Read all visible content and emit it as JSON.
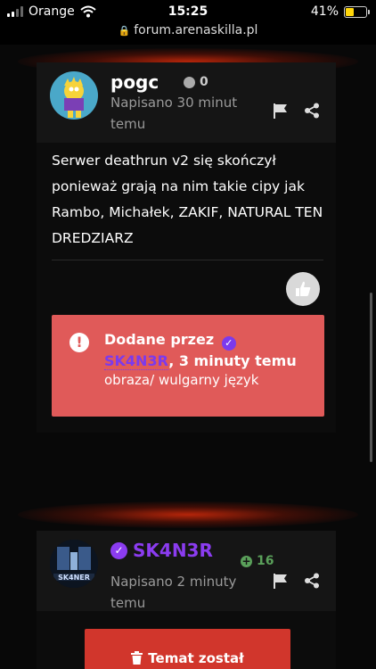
{
  "status_bar": {
    "carrier": "Orange",
    "time": "15:25",
    "battery": "41%",
    "battery_level": 0.41
  },
  "url_bar": {
    "domain": "forum.arenaskilla.pl"
  },
  "post1": {
    "username": "pogc",
    "reputation": "0",
    "posted": "Napisano 30 minut temu",
    "body": "Serwer deathrun v2 się skończył ponieważ grają na nim takie cipy jak Rambo, Michałek, ZAKIF, NATURAL TEN DREDZIARZ",
    "moderation": {
      "prefix": "Dodane przez",
      "moderator": "SK4N3R",
      "time": ", 3 minuty temu",
      "reason": "obraza/ wulgarny język"
    }
  },
  "post2": {
    "username": "SK4N3R",
    "reputation": "16",
    "posted": "Napisano 2 minuty temu",
    "avatar_text": "SK4NER"
  },
  "locked_button": {
    "label": "Temat został"
  },
  "colors": {
    "moderation_bg": "#e05a59",
    "moderator_purple": "#7c3aed",
    "locked_red": "#d1362c",
    "rep_green": "#5aa05a"
  }
}
